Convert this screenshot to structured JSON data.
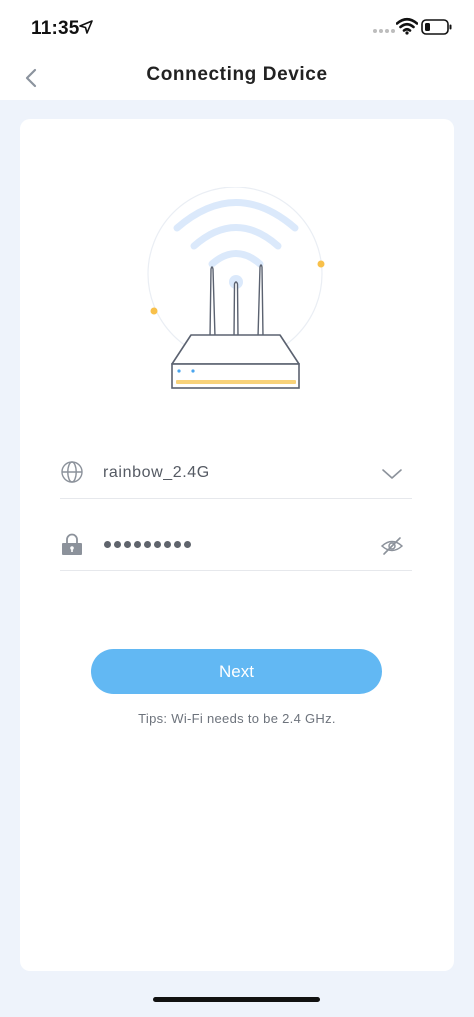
{
  "status_bar": {
    "time": "11:35",
    "icons": [
      "location-arrow-icon",
      "signal-dots-icon",
      "wifi-icon",
      "battery-icon"
    ]
  },
  "nav": {
    "title": "Connecting Device",
    "back_icon": "chevron-left-icon"
  },
  "form": {
    "wifi_network": {
      "icon": "globe-icon",
      "value": "rainbow_2.4G",
      "dropdown_icon": "chevron-down-icon"
    },
    "password": {
      "icon": "lock-icon",
      "masked_length": 9,
      "visibility_icon": "eye-slash-icon"
    }
  },
  "actions": {
    "next_label": "Next"
  },
  "tips": "Tips: Wi-Fi needs to be 2.4 GHz.",
  "colors": {
    "accent": "#62b8f3",
    "page_background": "#eef3fb",
    "wifi_waves": "#dbe9fb",
    "orange_dots": "#f8c04a"
  }
}
